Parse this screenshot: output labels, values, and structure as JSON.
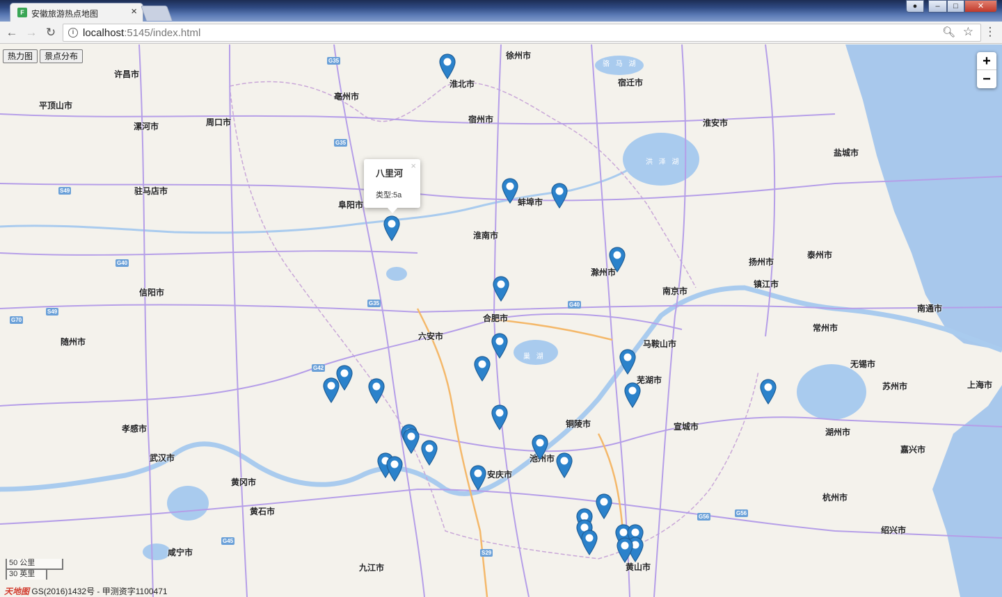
{
  "browser": {
    "tab_title": "安徽旅游热点地图",
    "url_host": "localhost",
    "url_path": ":5145/index.html",
    "favicon_letter": "F"
  },
  "map": {
    "layer_buttons": [
      "热力图",
      "景点分布"
    ],
    "zoom_in": "+",
    "zoom_out": "−",
    "popup": {
      "title": "八里河",
      "type_text": "类型:5a",
      "close": "×"
    },
    "scale_km": "50 公里",
    "scale_mi": "30 英里",
    "copyright": "GS(2016)1432号 - 甲测资字1100471",
    "copyright_logo": "天地图",
    "cities": [
      "淮北市",
      "宿迁市",
      "亳州市",
      "宿州市",
      "淮安市",
      "周口市",
      "漯河市",
      "平顶山市",
      "许昌市",
      "盐城市",
      "驻马店市",
      "阜阳市",
      "蚌埠市",
      "淮南市",
      "滁州市",
      "扬州市",
      "泰州市",
      "南京市",
      "镇江市",
      "南通市",
      "常州市",
      "信阳市",
      "合肥市",
      "六安市",
      "马鞍山市",
      "芜湖市",
      "无锡市",
      "苏州市",
      "上海市",
      "随州市",
      "铜陵市",
      "宣城市",
      "湖州市",
      "孝感市",
      "武汉市",
      "池州市",
      "安庆市",
      "嘉兴市",
      "黄冈市",
      "杭州市",
      "黄石市",
      "绍兴市",
      "咸宁市",
      "黄山市",
      "九江市",
      "徐州市"
    ],
    "lakes": [
      "洪 泽 湖",
      "骆 马 湖",
      "巢 湖"
    ],
    "highways": [
      "G35",
      "G35",
      "S49",
      "G40",
      "G35",
      "G40",
      "G42",
      "G70",
      "S49",
      "G45",
      "S29",
      "G56",
      "G56"
    ]
  }
}
